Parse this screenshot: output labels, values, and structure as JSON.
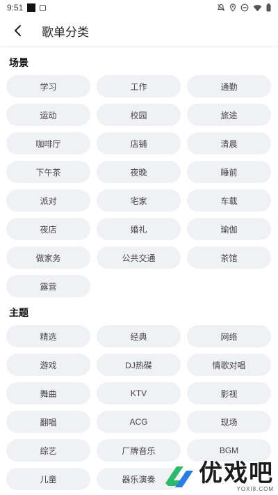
{
  "status_bar": {
    "time": "9:51"
  },
  "header": {
    "title": "歌单分类"
  },
  "sections": [
    {
      "title": "场景",
      "items": [
        "学习",
        "工作",
        "通勤",
        "运动",
        "校园",
        "旅途",
        "咖啡厅",
        "店铺",
        "清晨",
        "下午茶",
        "夜晚",
        "睡前",
        "派对",
        "宅家",
        "车载",
        "夜店",
        "婚礼",
        "瑜伽",
        "做家务",
        "公共交通",
        "茶馆",
        "露营"
      ]
    },
    {
      "title": "主题",
      "items": [
        "精选",
        "经典",
        "网络",
        "游戏",
        "DJ热碟",
        "情歌对唱",
        "舞曲",
        "KTV",
        "影视",
        "翻唱",
        "ACG",
        "现场",
        "综艺",
        "厂牌音乐",
        "BGM",
        "儿童",
        "器乐演奏"
      ]
    }
  ],
  "watermark": {
    "text": "优戏吧",
    "sub": "YOXI8.COM",
    "colors": {
      "green": "#2db86b",
      "blue": "#2a7de1"
    }
  }
}
